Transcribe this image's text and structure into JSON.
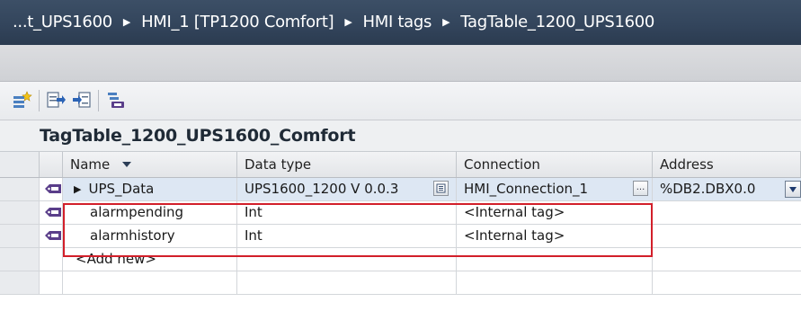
{
  "breadcrumb": {
    "items": [
      "...t_UPS1600",
      "HMI_1 [TP1200 Comfort]",
      "HMI tags",
      "TagTable_1200_UPS1600"
    ],
    "separator": "▶"
  },
  "toolbar": {
    "icons": [
      "add-tag-icon",
      "export-icon",
      "import-icon",
      "tag-settings-icon"
    ]
  },
  "table": {
    "title": "TagTable_1200_UPS1600_Comfort",
    "columns": {
      "name": "Name",
      "data_type": "Data type",
      "connection": "Connection",
      "address": "Address"
    },
    "rows": [
      {
        "name": "UPS_Data",
        "data_type": "UPS1600_1200 V 0.0.3",
        "connection": "HMI_Connection_1",
        "address": "%DB2.DBX0.0"
      },
      {
        "name": "alarmpending",
        "data_type": "Int",
        "connection": "<Internal tag>",
        "address": ""
      },
      {
        "name": "alarmhistory",
        "data_type": "Int",
        "connection": "<Internal tag>",
        "address": ""
      }
    ],
    "add_new": "<Add new>",
    "ellipsis_label": "..."
  },
  "colors": {
    "breadcrumb_bg": "#33455c",
    "highlight_border": "#d21f2a",
    "selected_row": "#dde7f3"
  }
}
